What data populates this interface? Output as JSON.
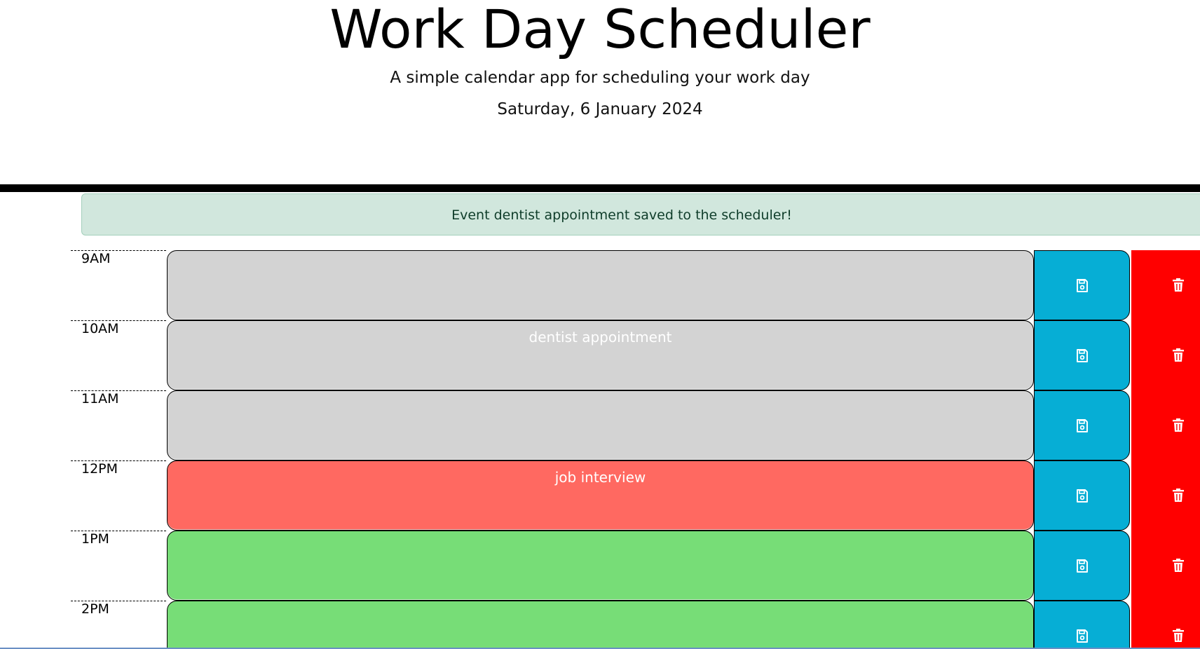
{
  "header": {
    "title": "Work Day Scheduler",
    "subtitle": "A simple calendar app for scheduling your work day",
    "current_day": "Saturday, 6 January 2024"
  },
  "alert": {
    "message": "Event dentist appointment saved to the scheduler!"
  },
  "colors": {
    "past": "#d3d3d3",
    "present": "#ff6961",
    "future": "#77dd77",
    "save": "#06aed5",
    "delete": "#ff0000",
    "alert_bg": "#d1e7dd"
  },
  "icons": {
    "save": "floppy-disk-icon",
    "delete": "trash-icon"
  },
  "time_blocks": [
    {
      "hour": "9AM",
      "event": "",
      "status": "past"
    },
    {
      "hour": "10AM",
      "event": "dentist appointment",
      "status": "past"
    },
    {
      "hour": "11AM",
      "event": "",
      "status": "past"
    },
    {
      "hour": "12PM",
      "event": "job interview",
      "status": "present"
    },
    {
      "hour": "1PM",
      "event": "",
      "status": "future"
    },
    {
      "hour": "2PM",
      "event": "",
      "status": "future"
    }
  ]
}
